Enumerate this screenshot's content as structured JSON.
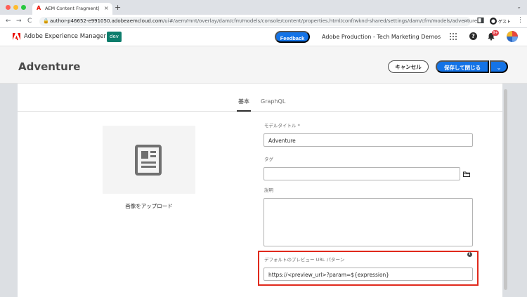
{
  "browser": {
    "tab_title": "AEM Content Fragment| Mod",
    "tab_favicon": "A",
    "tab_close": "×",
    "new_tab": "+",
    "tabs_menu": "⌄",
    "url_host": "author-p46652-e991050.adobeaemcloud.com",
    "url_path": "/ui#/aem/mnt/overlay/dam/cfm/models/console/content/properties.html/conf/wknd-shared/settings/dam/cfm/models/adventure",
    "back": "←",
    "forward": "→",
    "reload": "C",
    "zoom_icon": "⌕",
    "guest_label": "ゲスト"
  },
  "shell": {
    "app_name": "Adobe Experience Manager",
    "env_badge": "dev",
    "feedback_label": "Feedback",
    "org_name": "Adobe Production - Tech Marketing Demos",
    "help_glyph": "?",
    "notification_count": "9+"
  },
  "header": {
    "title": "Adventure",
    "cancel_label": "キャンセル",
    "save_label": "保存して閉じる",
    "save_menu_glyph": "⌄"
  },
  "tabs": [
    {
      "label": "基本"
    },
    {
      "label": "GraphQL"
    }
  ],
  "thumbnail": {
    "upload_label": "画像をアップロード"
  },
  "form": {
    "model_title_label": "モデルタイトル *",
    "model_title_value": "Adventure",
    "tag_label": "タグ",
    "description_label": "説明",
    "preview_url_label": "デフォルトのプレビュー URL パターン",
    "preview_url_value": "https://<preview_url>?param=${expression}",
    "info_glyph": "i"
  },
  "colors": {
    "accent": "#1473e6",
    "env_badge": "#0d7d6c",
    "highlight": "#e0291c"
  }
}
